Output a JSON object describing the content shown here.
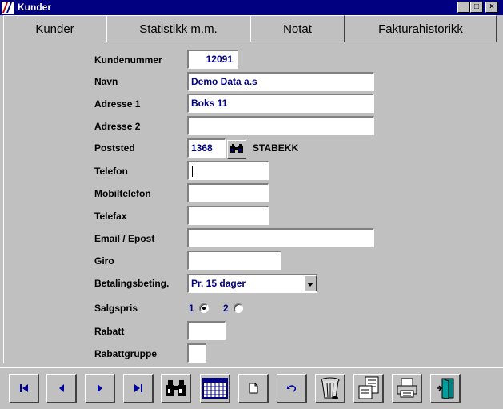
{
  "window": {
    "title": "Kunder",
    "minimize": "_",
    "maximize": "□",
    "close": "×"
  },
  "tabs": [
    {
      "label": "Kunder",
      "active": true
    },
    {
      "label": "Statistikk m.m.",
      "active": false
    },
    {
      "label": "Notat",
      "active": false
    },
    {
      "label": "Fakturahistorikk",
      "active": false
    }
  ],
  "form": {
    "kundenummer": {
      "label": "Kundenummer",
      "value": "12091"
    },
    "navn": {
      "label": "Navn",
      "value": "Demo Data a.s"
    },
    "adresse1": {
      "label": "Adresse 1",
      "value": "Boks 11"
    },
    "adresse2": {
      "label": "Adresse 2",
      "value": ""
    },
    "poststed": {
      "label": "Poststed",
      "value": "1368",
      "city": "STABEKK"
    },
    "telefon": {
      "label": "Telefon",
      "value": ""
    },
    "mobiltelefon": {
      "label": "Mobiltelefon",
      "value": ""
    },
    "telefax": {
      "label": "Telefax",
      "value": ""
    },
    "email": {
      "label": "Email / Epost",
      "value": ""
    },
    "giro": {
      "label": "Giro",
      "value": ""
    },
    "betaling": {
      "label": "Betalingsbeting.",
      "value": "Pr. 15 dager"
    },
    "salgspris": {
      "label": "Salgspris",
      "option1": "1",
      "option2": "2",
      "selected": "1"
    },
    "rabatt": {
      "label": "Rabatt",
      "value": ""
    },
    "rabattgruppe": {
      "label": "Rabattgruppe",
      "value": ""
    }
  },
  "toolbar": [
    "first-record-icon",
    "previous-record-icon",
    "next-record-icon",
    "last-record-icon",
    "binoculars-icon",
    "calendar-icon",
    "new-document-icon",
    "undo-icon",
    "trash-icon",
    "forms-icon",
    "printer-icon",
    "exit-door-icon"
  ],
  "colors": {
    "titlebar": "#000080",
    "field_text": "#000080",
    "face": "#c0c0c0"
  }
}
